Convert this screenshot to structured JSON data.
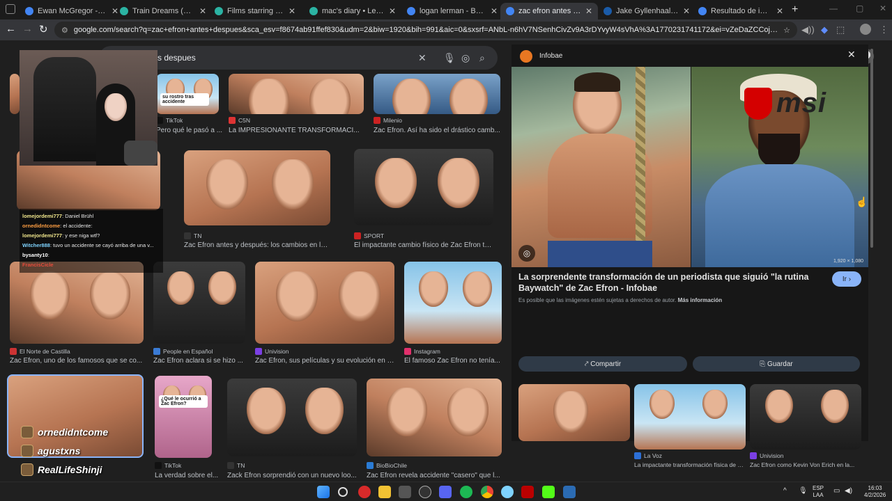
{
  "browser": {
    "tabs": [
      {
        "title": "Ewan McGregor - Buscar",
        "color": "#4285f4"
      },
      {
        "title": "Train Dreams (2025) dire",
        "color": "#2bb3a3"
      },
      {
        "title": "Films starring Joel Edgert",
        "color": "#2bb3a3"
      },
      {
        "title": "mac's diary • Letterboxd",
        "color": "#2bb3a3"
      },
      {
        "title": "logan lerman - Buscar con",
        "color": "#4285f4"
      },
      {
        "title": "zac efron antes despues -",
        "color": "#4285f4",
        "active": true
      },
      {
        "title": "Jake Gyllenhaal: sus roma",
        "color": "#1a5ba8"
      },
      {
        "title": "Resultado de imágenes de",
        "color": "#4285f4"
      }
    ],
    "new_tab": "+",
    "url": "google.com/search?q=zac+efron+antes+despues&sca_esv=f8674ab91ffef830&udm=2&biw=1920&bih=991&aic=0&sxsrf=ANbL-n6hV7NSenhCivZv9A3rDYvyW4sVhA%3A1770231741172&ei=vZeDaZCCojs1sQPn6-cgAs&oq=zac+efron+antes+dcc+ant..."
  },
  "search": {
    "query_visible": "s despues"
  },
  "results": [
    {
      "source": "TikTok",
      "caption": "Pero qué le pasó a ...",
      "fav": "#111111",
      "overlay": "su rostro tras accidente"
    },
    {
      "source": "C5N",
      "caption": "La IMPRESIONANTE TRANSFORMACI...",
      "fav": "#d33"
    },
    {
      "source": "Milenio",
      "caption": "Zac Efron. Así ha sido el drástico camb...",
      "fav": "#c22"
    },
    {
      "source": "TN",
      "caption": "Zac Efron antes y después: los cambios en la apa...",
      "fav": "#333"
    },
    {
      "source": "SPORT",
      "caption": "El impactante cambio físico de Zac Efron tras su...",
      "fav": "#c22"
    },
    {
      "source": "El Norte de Castilla",
      "caption": "Zac Efron, uno de los famosos que se co...",
      "fav": "#c33"
    },
    {
      "source": "People en Español",
      "caption": "Zac Efron aclara si se hizo ...",
      "fav": "#3a7bd5"
    },
    {
      "source": "Univision",
      "caption": "Zac Efron, sus películas y su evolución en l...",
      "fav": "#7b3fe4"
    },
    {
      "source": "Instagram",
      "caption": "El famoso Zac Efron no tenía...",
      "fav": "#e1306c"
    },
    {
      "source": "TikTok",
      "caption": "La verdad sobre el...",
      "fav": "#111111",
      "overlay": "¿Qué le ocurrió a Zac Efron?"
    },
    {
      "source": "TN",
      "caption": "Zack Efron sorprendió con un nuevo loo...",
      "fav": "#333"
    },
    {
      "source": "BioBioChile",
      "caption": "Zac Efron revela accidente \"casero\" que l...",
      "fav": "#2a7bd5"
    }
  ],
  "panel": {
    "source": "Infobae",
    "title": "La sorprendente transformación de un periodista que siguió \"la rutina Baywatch\" de Zac Efron - Infobae",
    "go_button": "Ir",
    "copyright": "Es posible que las imágenes estén sujetas a derechos de autor.",
    "more_info": "Más información",
    "dimensions": "1,920 × 1,080",
    "share": "Compartir",
    "save": "Guardar",
    "related": [
      {
        "source": "La Voz",
        "caption": "La impactante transformación física de Z..."
      },
      {
        "source": "Univision",
        "caption": "Zac Efron como Kevin Von Erich en la..."
      }
    ]
  },
  "overlays": {
    "chat": [
      {
        "user": "lomejordemi777",
        "text": ": Daniel Brühl"
      },
      {
        "user": "ornedidntcome",
        "text": ": el accidente:"
      },
      {
        "user": "lomejordemi777",
        "text": ": y ese niga wtf?"
      },
      {
        "user": "Witcher888",
        "text": ": tuvo un accidente se cayó arriba de una v..."
      },
      {
        "user": "bysanty10",
        "text": ":"
      },
      {
        "user": "FrancisCicle",
        "text": ""
      }
    ],
    "alerts": [
      "ornedidntcome",
      "agustxns",
      "RealLifeShinji"
    ],
    "sponsor": "msi"
  },
  "taskbar": {
    "lang": "ESP",
    "region": "LAA",
    "time": "16:03",
    "date": "4/2/2026"
  }
}
